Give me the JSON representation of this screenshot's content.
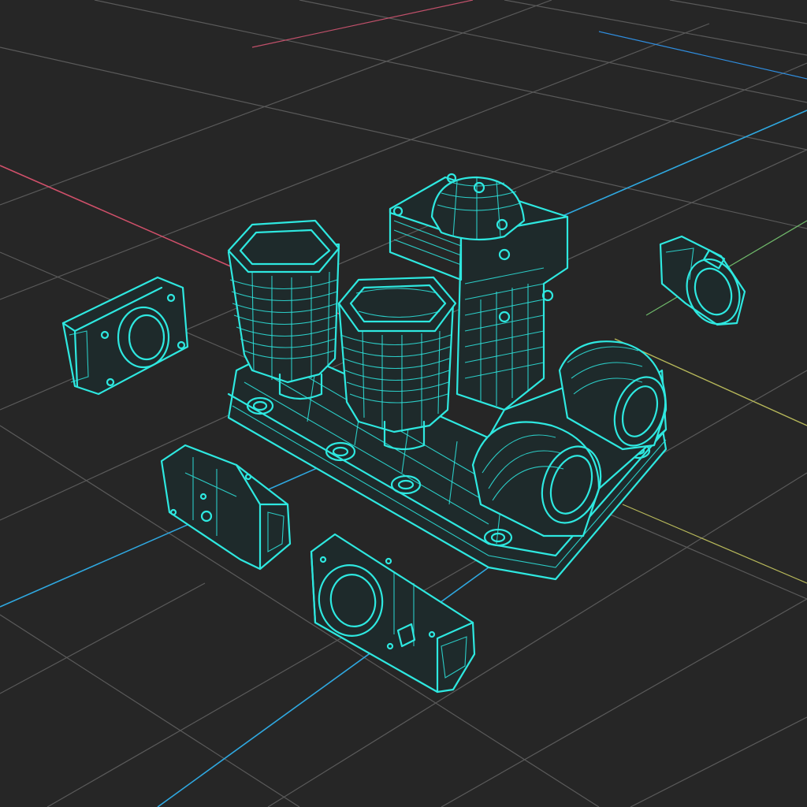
{
  "scene": {
    "description_hidden": "",
    "colors": {
      "background": "#262626",
      "grid": "#5a5a5a",
      "wireframe": "#2ee8e0",
      "axis_x": "#d0506a",
      "axis_y": "#2fa8e0",
      "axis_z": "#b7b85a"
    },
    "objects": [
      "manifold-base",
      "cylinder-left",
      "cylinder-center",
      "pump-housing",
      "twin-port-block",
      "exploded-flange-left",
      "exploded-flange-right",
      "exploded-cover-front-left",
      "exploded-cover-front"
    ]
  }
}
